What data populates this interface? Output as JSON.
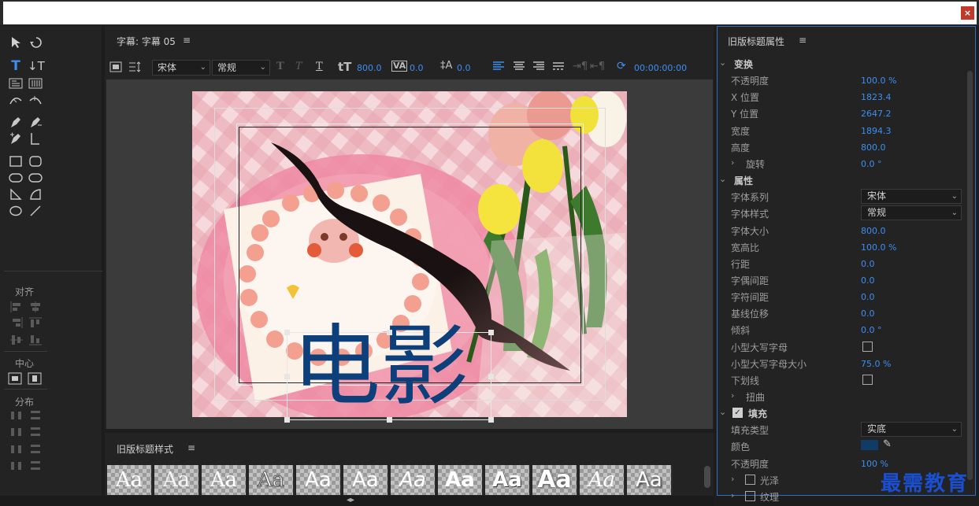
{
  "window": {
    "close_label": "×"
  },
  "tools": {
    "align_label": "对齐",
    "center_label": "中心",
    "distribute_label": "分布"
  },
  "main": {
    "title": "字幕: 字幕 05",
    "menu_icon": "≡",
    "toolbar": {
      "font_family": "宋体",
      "font_style": "常规",
      "font_size": "800.0",
      "kerning": "0.0",
      "leading": "0.0",
      "timecode": "00:00:00:00"
    },
    "caption_text": "电影"
  },
  "styles": {
    "title": "旧版标题样式",
    "menu_icon": "≡",
    "swatches": [
      "Aa",
      "Aa",
      "Aa",
      "Aa",
      "Aa",
      "Aa",
      "Aa",
      "Aa",
      "Aa",
      "Aa",
      "Aa",
      "Aa"
    ]
  },
  "props": {
    "title": "旧版标题属性",
    "menu_icon": "≡",
    "rows": [
      {
        "type": "section",
        "label": "变换"
      },
      {
        "type": "value",
        "label": "不透明度",
        "value": "100.0 %"
      },
      {
        "type": "value",
        "label": "X 位置",
        "value": "1823.4"
      },
      {
        "type": "value",
        "label": "Y 位置",
        "value": "2647.2"
      },
      {
        "type": "value",
        "label": "宽度",
        "value": "1894.3"
      },
      {
        "type": "value",
        "label": "高度",
        "value": "800.0"
      },
      {
        "type": "subsection",
        "label": "旋转",
        "value": "0.0 °"
      },
      {
        "type": "section",
        "label": "属性"
      },
      {
        "type": "dropdown",
        "label": "字体系列",
        "value": "宋体"
      },
      {
        "type": "dropdown",
        "label": "字体样式",
        "value": "常规"
      },
      {
        "type": "value",
        "label": "字体大小",
        "value": "800.0"
      },
      {
        "type": "value",
        "label": "宽高比",
        "value": "100.0 %"
      },
      {
        "type": "value",
        "label": "行距",
        "value": "0.0"
      },
      {
        "type": "value",
        "label": "字偶间距",
        "value": "0.0"
      },
      {
        "type": "value",
        "label": "字符间距",
        "value": "0.0"
      },
      {
        "type": "value",
        "label": "基线位移",
        "value": "0.0"
      },
      {
        "type": "value",
        "label": "倾斜",
        "value": "0.0 °"
      },
      {
        "type": "check",
        "label": "小型大写字母"
      },
      {
        "type": "value",
        "label": "小型大写字母大小",
        "value": "75.0 %"
      },
      {
        "type": "check",
        "label": "下划线"
      },
      {
        "type": "subsection",
        "label": "扭曲"
      },
      {
        "type": "checksection",
        "label": "填充"
      },
      {
        "type": "dropdown",
        "label": "填充类型",
        "value": "实底"
      },
      {
        "type": "color",
        "label": "颜色"
      },
      {
        "type": "value",
        "label": "不透明度",
        "value": "100 %"
      },
      {
        "type": "subcheck",
        "label": "光泽"
      },
      {
        "type": "subcheck",
        "label": "纹理"
      }
    ]
  },
  "watermark": "最需教育",
  "colors": {
    "accent": "#3e8ef0",
    "fill_color": "#123a66",
    "caption_color": "#0d3f7a"
  }
}
